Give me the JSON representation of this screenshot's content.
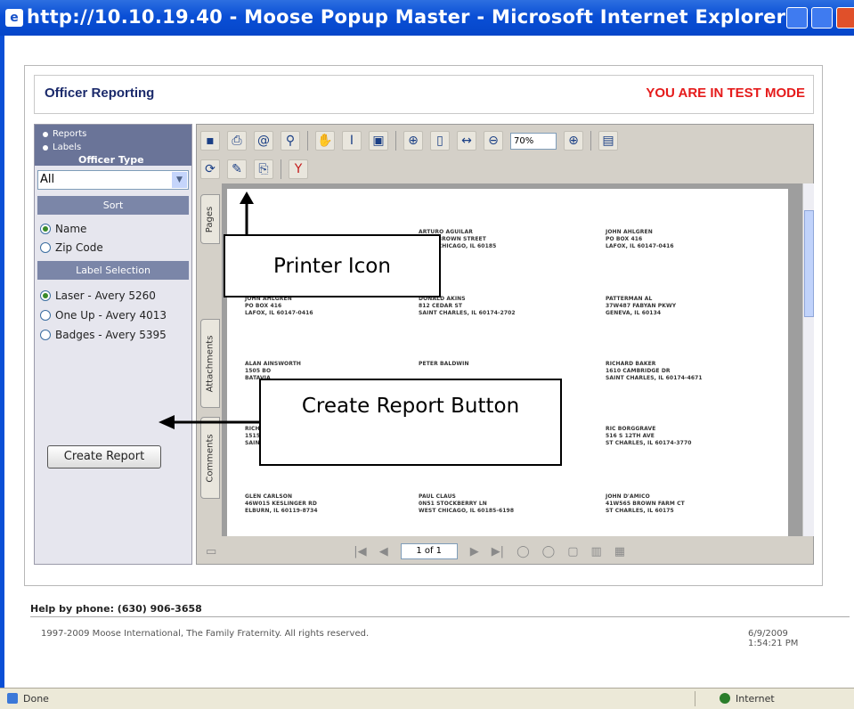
{
  "window": {
    "title": "http://10.10.19.40 - Moose Popup Master - Microsoft Internet Explorer"
  },
  "header": {
    "title": "Officer Reporting",
    "mode": "YOU ARE IN TEST MODE"
  },
  "sidebar": {
    "report_type": [
      {
        "label": "Reports",
        "selected": false
      },
      {
        "label": "Labels",
        "selected": true
      }
    ],
    "officer_type_label": "Officer Type",
    "officer_type_value": "All",
    "sort_heading": "Sort",
    "sort_options": [
      {
        "label": "Name",
        "selected": true
      },
      {
        "label": "Zip Code",
        "selected": false
      }
    ],
    "label_heading": "Label Selection",
    "label_options": [
      {
        "label": "Laser - Avery 5260",
        "selected": true
      },
      {
        "label": "One Up - Avery 4013",
        "selected": false
      },
      {
        "label": "Badges - Avery 5395",
        "selected": false
      }
    ],
    "create_button": "Create Report"
  },
  "viewer": {
    "zoom": "70%",
    "tabs": [
      "Pages",
      "Attachments",
      "Comments"
    ],
    "page_indicator": "1 of 1",
    "labels": [
      [
        "ARTURO AGUILAR",
        "555 E BROWN STREET",
        "WEST CHICAGO, IL 60185"
      ],
      [
        "JOHN AHLGREN",
        "PO BOX 416",
        "LAFOX, IL 60147-0416"
      ],
      [
        "JOHN AHLGREN",
        "PO BOX 416",
        "LAFOX, IL 60147-0416"
      ],
      [
        "DONALD AKINS",
        "812 CEDAR ST",
        "SAINT CHARLES, IL 60174-2702"
      ],
      [
        "PATTERMAN AL",
        "37W487 FABYAN PKWY",
        "GENEVA, IL 60134"
      ],
      [
        "ALAN AINSWORTH",
        "1505 BO",
        "BATAVIA"
      ],
      [
        "PETER BALDWIN",
        ""
      ],
      [
        "RICHARD BAKER",
        "1610 CAMBRIDGE DR",
        "SAINT CHARLES, IL 60174-4671"
      ],
      [
        "RICHARD",
        "1515 EA",
        "SAINT C"
      ],
      [
        "RIC BORGGRAVE",
        "516 S 12TH AVE",
        "ST CHARLES, IL 60174-3770"
      ],
      [
        "GLEN CARLSON",
        "46W015 KESLINGER RD",
        "ELBURN, IL 60119-8734"
      ],
      [
        "PAUL CLAUS",
        "0N51 STOCKBERRY LN",
        "WEST CHICAGO, IL 60185-6198"
      ],
      [
        "JOHN D'AMICO",
        "41W565 BROWN FARM CT",
        "ST CHARLES, IL 60175"
      ]
    ]
  },
  "footer": {
    "help": "Help by phone: (630) 906-3658",
    "copyright": "1997-2009 Moose International, The Family Fraternity. All rights reserved.",
    "datetime": "6/9/2009 1:54:21 PM"
  },
  "statusbar": {
    "status": "Done",
    "zone": "Internet"
  },
  "annotations": {
    "printer": "Printer Icon",
    "create": "Create Report Button"
  }
}
